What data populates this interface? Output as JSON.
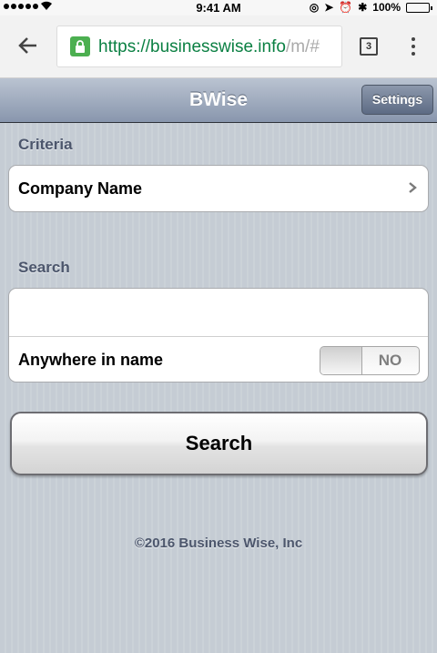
{
  "status_bar": {
    "time": "9:41 AM",
    "battery": "100%",
    "battery_level": 1.0,
    "icons": [
      "signal-dots-icon",
      "wifi-icon",
      "lock-rotation-icon",
      "location-icon",
      "alarm-icon",
      "bluetooth-icon",
      "battery-icon"
    ]
  },
  "browser": {
    "url_scheme": "https://",
    "url_host": "businesswise.info",
    "url_path": "/m/#",
    "tab_count": "3",
    "secure_color": "#4caf50"
  },
  "app": {
    "title": "BWise",
    "settings_label": "Settings"
  },
  "criteria": {
    "section_label": "Criteria",
    "selected": "Company Name"
  },
  "search": {
    "section_label": "Search",
    "input_value": "",
    "input_placeholder": "",
    "anywhere_label": "Anywhere in name",
    "anywhere_value": "NO",
    "button_label": "Search"
  },
  "footer": {
    "copyright": "©2016 Business Wise, Inc"
  }
}
